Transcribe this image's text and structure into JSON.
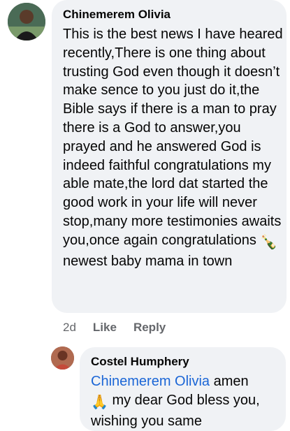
{
  "comment": {
    "author": "Chinemerem Olivia",
    "text_before_emoji": "This is the best news I have heared recently,There is one thing about trusting God even though it doesn’t make sence to you just do it,the Bible says if there is a man to pray there is a God to answer,you prayed and he answered God is indeed faithful congratulations my able mate,the lord dat started the good work in your life will never stop,many more testimonies awaits you,once again congratulations ",
    "emoji": "🍾",
    "text_after_emoji": " newest baby mama in town",
    "time": "2d",
    "like_label": "Like",
    "reply_label": "Reply"
  },
  "reply": {
    "author": "Costel Humphery",
    "mention": "Chinemerem Olivia",
    "text_after_mention": " amen",
    "emoji": "🙏",
    "text_after_emoji": " my dear God bless you, wishing you same"
  }
}
